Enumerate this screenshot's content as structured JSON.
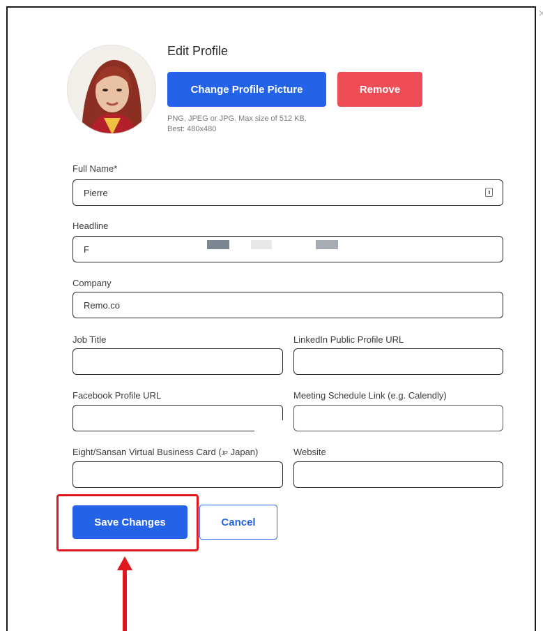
{
  "modal": {
    "title": "Edit Profile",
    "change_picture_label": "Change Profile Picture",
    "remove_label": "Remove",
    "hint_line1": "PNG, JPEG or JPG. Max size of 512 KB.",
    "hint_line2": "Best: 480x480"
  },
  "form": {
    "full_name": {
      "label": "Full Name*",
      "value": "Pierre"
    },
    "headline": {
      "label": "Headline",
      "value": "F"
    },
    "company": {
      "label": "Company",
      "value": "Remo.co"
    },
    "job_title": {
      "label": "Job Title",
      "value": ""
    },
    "linkedin": {
      "label": "LinkedIn Public Profile URL",
      "value": ""
    },
    "facebook": {
      "label": "Facebook Profile URL",
      "value": ""
    },
    "meeting": {
      "label": "Meeting Schedule Link (e.g. Calendly)",
      "value": ""
    },
    "eight_sansan": {
      "label_main": "Eight/Sansan Virtual Business Card (",
      "label_flag": "JP",
      "label_tail": " Japan)",
      "value": ""
    },
    "website": {
      "label": "Website",
      "value": ""
    }
  },
  "actions": {
    "save_label": "Save Changes",
    "cancel_label": "Cancel"
  },
  "annotation": {
    "highlight_color": "#e0171d"
  },
  "colors": {
    "primary": "#2463e8",
    "danger": "#ee4d55"
  }
}
